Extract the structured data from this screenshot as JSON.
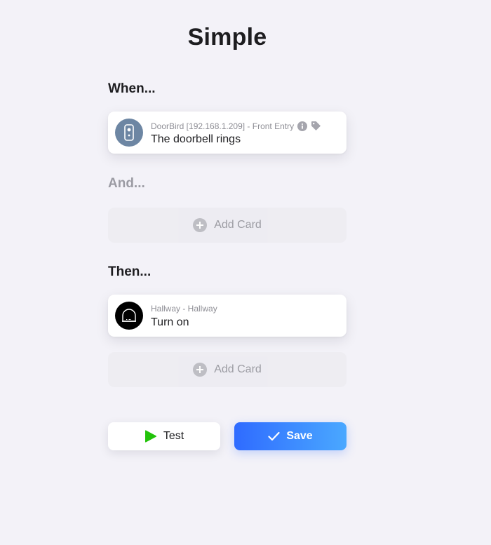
{
  "header": {
    "title": "Simple"
  },
  "when": {
    "label": "When...",
    "card": {
      "device": "DoorBird [192.168.1.209] - Front Entry",
      "text": "The doorbell rings",
      "icon": "doorbell-icon",
      "icon_bg": "#6d86a3"
    }
  },
  "and": {
    "label": "And...",
    "add_card_label": "Add Card"
  },
  "then": {
    "label": "Then...",
    "card": {
      "device": "Hallway - Hallway",
      "text": "Turn on",
      "icon": "light-fixture-icon",
      "icon_bg": "#000000"
    },
    "add_card_label": "Add Card"
  },
  "actions": {
    "test_label": "Test",
    "save_label": "Save",
    "test_icon_color": "#22c30a",
    "save_gradient": [
      "#2f6bff",
      "#4aa8ff"
    ]
  }
}
